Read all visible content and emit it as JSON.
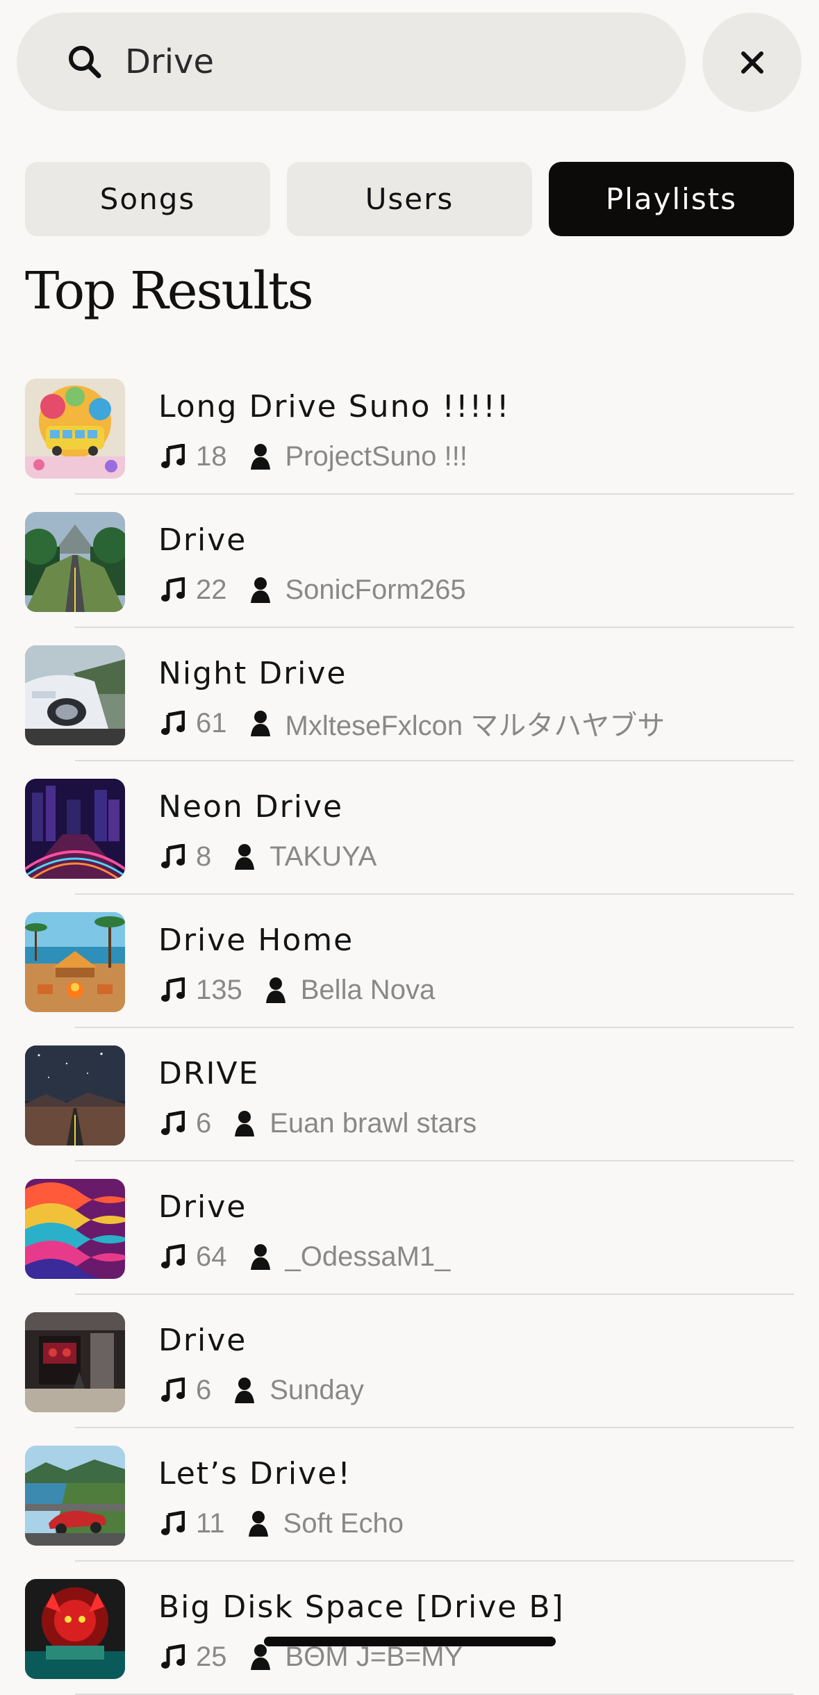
{
  "search": {
    "value": "Drive",
    "placeholder": ""
  },
  "tabs": [
    {
      "label": "Songs",
      "active": false
    },
    {
      "label": "Users",
      "active": false
    },
    {
      "label": "Playlists",
      "active": true
    }
  ],
  "section_title": "Top Results",
  "results": [
    {
      "title": "Long Drive Suno !!!!!",
      "songs": "18",
      "user": "ProjectSuno !!!",
      "thumb": "colorful-bus-art"
    },
    {
      "title": "Drive",
      "songs": "22",
      "user": "SonicForm265",
      "thumb": "forest-road"
    },
    {
      "title": "Night Drive",
      "songs": "61",
      "user": "MxlteseFxlcon マルタハヤブサ",
      "thumb": "white-sports-car"
    },
    {
      "title": "Neon Drive",
      "songs": "8",
      "user": "TAKUYA",
      "thumb": "neon-city"
    },
    {
      "title": "Drive Home",
      "songs": "135",
      "user": "Bella Nova",
      "thumb": "beach-campfire"
    },
    {
      "title": "DRIVE",
      "songs": "6",
      "user": "Euan brawl stars",
      "thumb": "night-sky-road"
    },
    {
      "title": "Drive",
      "songs": "64",
      "user": "_OdessaM1_",
      "thumb": "psychedelic-waves"
    },
    {
      "title": "Drive",
      "songs": "6",
      "user": "Sunday",
      "thumb": "dark-storefront"
    },
    {
      "title": "Let’s Drive!",
      "songs": "11",
      "user": "Soft Echo",
      "thumb": "coastal-red-car"
    },
    {
      "title": "Big Disk Space [Drive B]",
      "songs": "25",
      "user": "BΘM J=B=MY",
      "thumb": "red-demon-art"
    }
  ],
  "icons": {
    "search": "search-icon",
    "close": "close-icon",
    "song_count": "music-note-icon",
    "owner": "user-icon"
  },
  "colors": {
    "background": "#f9f8f6",
    "tab_inactive": "#ebe9e6",
    "tab_active": "#0d0a0a",
    "meta_text": "#8a8886"
  }
}
